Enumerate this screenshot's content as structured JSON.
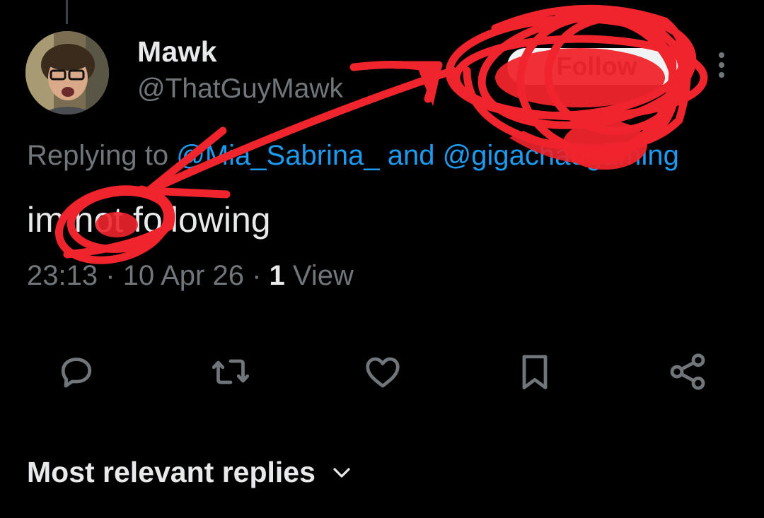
{
  "user": {
    "display_name": "Mawk",
    "handle": "@ThatGuyMawk",
    "follow_label": "Follow"
  },
  "reply_context": {
    "prefix": "Replying to",
    "mention_1": "@Mia_Sabrina_",
    "joiner": "and",
    "mention_2": "@gigachadgaming"
  },
  "tweet": {
    "text": "im not following",
    "time": "23:13",
    "date": "10 Apr 26",
    "views_count": "1",
    "views_label": "View"
  },
  "actions": [
    {
      "name": "reply",
      "icon": "reply-icon"
    },
    {
      "name": "retweet",
      "icon": "retweet-icon"
    },
    {
      "name": "like",
      "icon": "heart-icon"
    },
    {
      "name": "bookmark",
      "icon": "bookmark-icon"
    },
    {
      "name": "share",
      "icon": "share-icon"
    }
  ],
  "replies": {
    "sort_label": "Most relevant replies"
  },
  "colors": {
    "background": "#000000",
    "primary_text": "#e7e9ea",
    "secondary_text": "#71767b",
    "link": "#1d9bf0",
    "annotation": "#f0242c"
  }
}
